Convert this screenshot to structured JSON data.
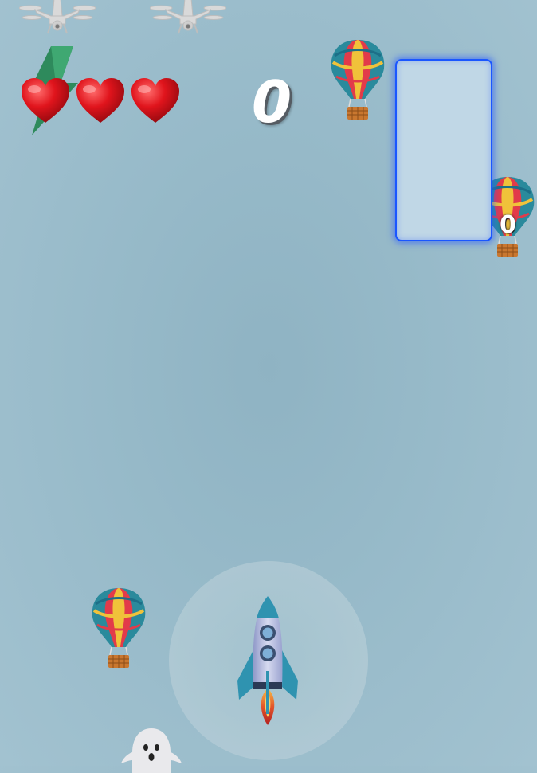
{
  "hud": {
    "score": "0",
    "lives": 3,
    "side_counter": "0"
  },
  "colors": {
    "heart": "#e0141c",
    "panel_border": "#1a56ff",
    "bolt": "#2e8a5c"
  },
  "icons": {
    "drone": "drone-icon",
    "heart": "heart-icon",
    "balloon": "hot-air-balloon-icon",
    "rocket": "rocket-icon",
    "ghost": "ghost-icon",
    "bolt": "lightning-bolt-icon"
  }
}
